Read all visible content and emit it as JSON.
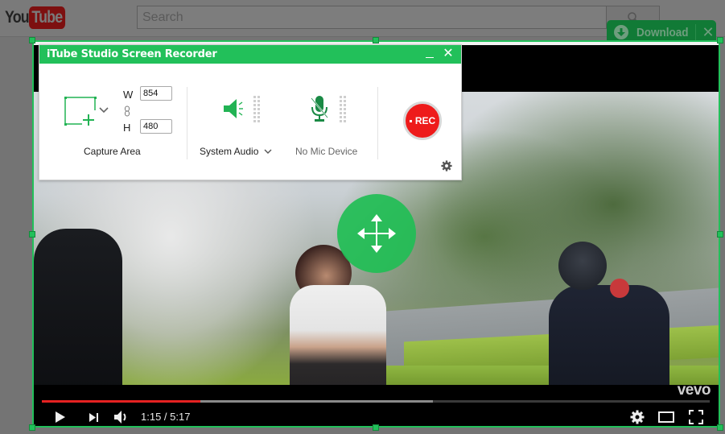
{
  "youtube": {
    "logo_you": "You",
    "logo_tube": "Tube",
    "search_placeholder": "Search",
    "search_icon": "search-icon"
  },
  "download_bar": {
    "label": "Download",
    "icon": "download-arrow-icon",
    "close_label": "✕"
  },
  "recorder": {
    "title": "iTube Studio Screen Recorder",
    "minimize_label": "_",
    "close_label": "✕",
    "capture": {
      "width_label": "W",
      "height_label": "H",
      "width_value": "854",
      "height_value": "480",
      "label": "Capture Area"
    },
    "system_audio": {
      "label": "System Audio",
      "state": "enabled"
    },
    "mic": {
      "label": "No Mic Device",
      "state": "muted"
    },
    "rec_button": {
      "label": "REC"
    },
    "colors": {
      "accent": "#22c05a",
      "rec": "#ee1b1b"
    }
  },
  "video_player": {
    "current_time": "1:15",
    "separator": " / ",
    "duration": "5:17",
    "time_display": "1:15 / 5:17",
    "played_fraction": 0.237,
    "buffered_fraction": 0.586,
    "watermark": "vevo",
    "colors": {
      "played": "#e52222",
      "buffered": "#8a8a8a"
    }
  }
}
